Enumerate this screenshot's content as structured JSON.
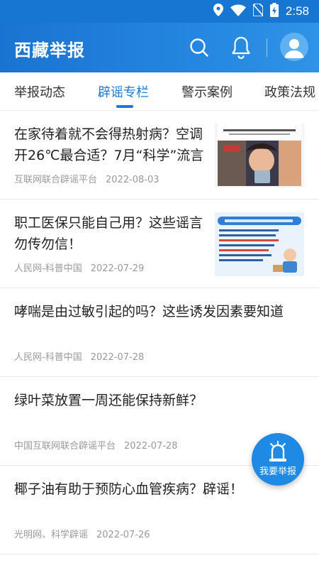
{
  "status_bar": {
    "time": "2:58"
  },
  "header": {
    "title": "西藏举报"
  },
  "tabs": [
    {
      "label": "举报动态",
      "active": false
    },
    {
      "label": "辟谣专栏",
      "active": true
    },
    {
      "label": "警示案例",
      "active": false
    },
    {
      "label": "政策法规",
      "active": false
    }
  ],
  "articles": [
    {
      "title": "在家待着就不会得热射病？空调开26℃最合适？7月“科学”流言",
      "source": "互联网联合辟谣平台",
      "date": "2022-08-03",
      "thumbnail": "news-image"
    },
    {
      "title": "职工医保只能自己用？这些谣言勿传勿信！",
      "source": "人民网-科普中国",
      "date": "2022-07-29",
      "thumbnail": "news-image"
    },
    {
      "title": "哮喘是由过敏引起的吗？这些诱发因素要知道",
      "source": "人民网-科普中国",
      "date": "2022-07-28"
    },
    {
      "title": "绿叶菜放置一周还能保持新鲜？",
      "source": "中国互联网联合辟谣平台",
      "date": "2022-07-28"
    },
    {
      "title": "椰子油有助于预防心血管疾病？辟谣！",
      "source": "光明网、科学辟谣",
      "date": "2022-07-26"
    }
  ],
  "fab": {
    "label": "我要举报",
    "icon": "alarm-siren-icon"
  },
  "colors": {
    "primary": "#1a7ad6",
    "header": "#1676d2",
    "text": "#222222",
    "meta": "#999999"
  }
}
